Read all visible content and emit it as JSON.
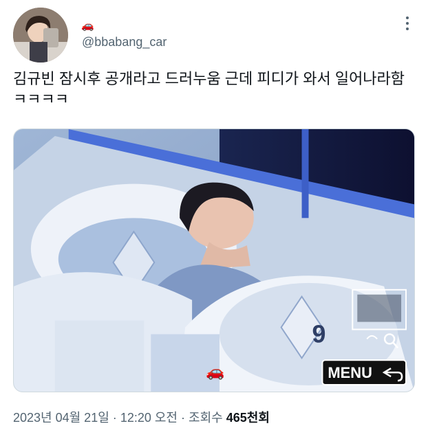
{
  "tweet": {
    "display_name_emoji": "🚗",
    "handle": "@bbabang_car",
    "text": "김규빈 잠시후 공개라고 드러누움 근데 피디가 와서 일어나라함\nㅋㅋㅋㅋ",
    "media": {
      "sticker_emoji": "🚗",
      "menu_label": "MENU",
      "dial_number": "9"
    },
    "date": "2023년 04월 21일",
    "separator": "·",
    "time": "12:20 오전",
    "views_label": "조회수",
    "views_count": "465",
    "views_unit": "천회"
  },
  "icons": {
    "more": "more-options-icon",
    "menu_return": "return-arrow-icon",
    "magnifier": "magnifier-icon"
  },
  "colors": {
    "text_primary": "#0f1419",
    "text_secondary": "#536471",
    "border": "#cfd9de"
  }
}
